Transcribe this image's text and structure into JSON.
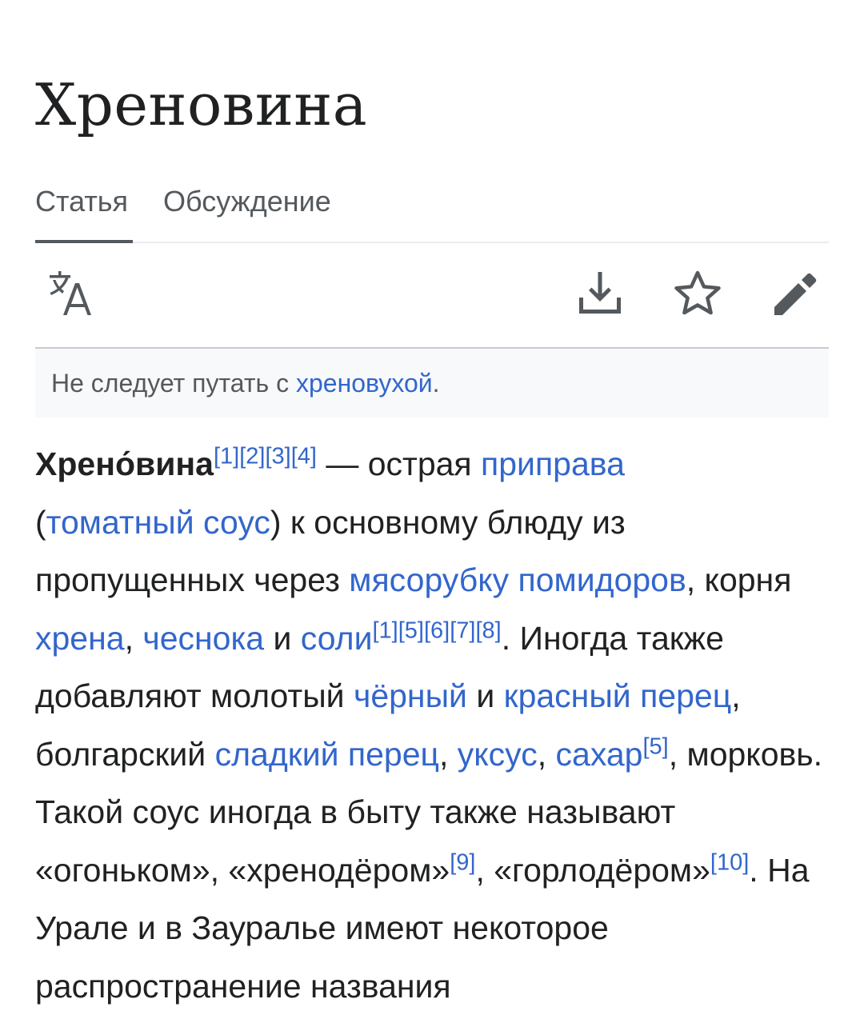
{
  "title": "Хреновина",
  "tabs": [
    {
      "label": "Статья",
      "active": true
    },
    {
      "label": "Обсуждение",
      "active": false
    }
  ],
  "toolbar": {
    "icons": [
      "language-icon",
      "download-icon",
      "star-icon",
      "edit-icon"
    ]
  },
  "hatnote": {
    "prefix": "Не следует путать с ",
    "link": "хреновухой",
    "suffix": "."
  },
  "paragraph": {
    "term": "Хрено́вина",
    "refs_1": "[1][2][3][4]",
    "t1": " — острая ",
    "l_pripava": "приправа",
    "t2": "(",
    "l_sous": "томатный соус",
    "t3": ") к основному блюду из пропущенных через ",
    "l_myasorubka": "мясорубку",
    "t4": " ",
    "l_pomidor": "помидоров",
    "t5": ", корня ",
    "l_hren": "хрена",
    "t6": ", ",
    "l_chesnok": "чеснока",
    "t7": " и ",
    "l_sol": "соли",
    "refs_2": "[1][5][6][7][8]",
    "t8": ". Иногда также добавляют молотый ",
    "l_cherny": "чёрный",
    "t9": " и ",
    "l_krasny": "красный перец",
    "t10": ", болгарский ",
    "l_sladky": "сладкий перец",
    "t11": ", ",
    "l_uksus": "уксус",
    "t12": ", ",
    "l_sahar": "сахар",
    "refs_3": "[5]",
    "t13": ", морковь. Такой соус иногда в быту также называют «огоньком», «хренодёром»",
    "refs_4": "[9]",
    "t14": ", «горлодёром»",
    "refs_5": "[10]",
    "t15": ". На Урале и в Зауралье имеют некоторое распространение названия"
  },
  "colors": {
    "link": "#3366cc",
    "text": "#202122",
    "secondary_text": "#54595d",
    "hatnote_bg": "#f8f9fa"
  }
}
